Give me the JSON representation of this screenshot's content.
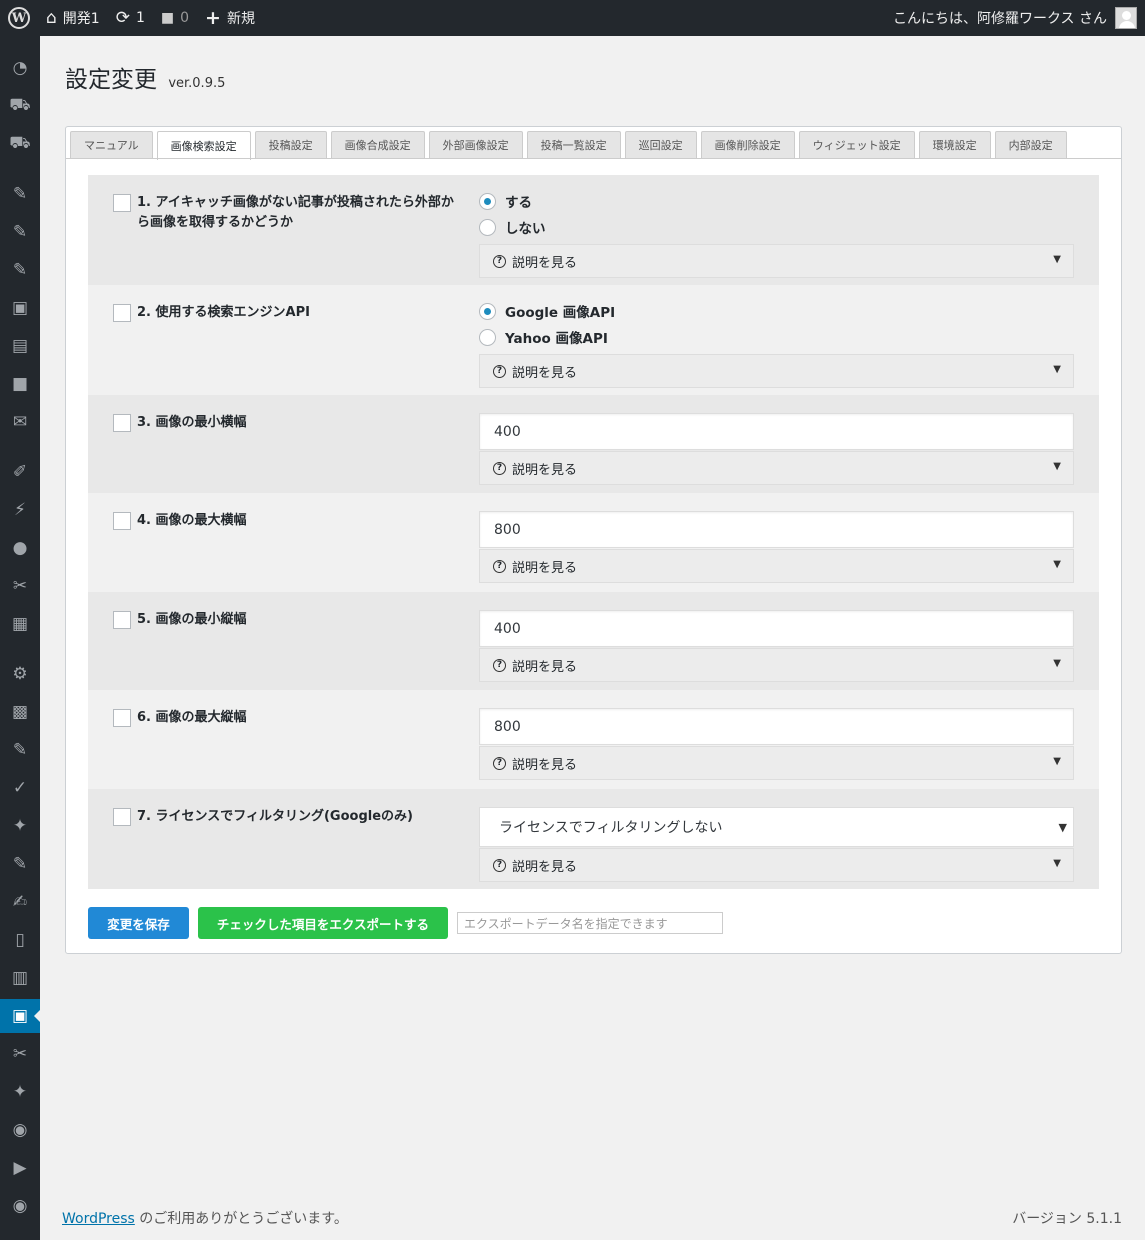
{
  "adminbar": {
    "site_name": "開発1",
    "updates_count": "1",
    "comments_count": "0",
    "new_label": "新規",
    "greeting": "こんにちは、阿修羅ワークス さん"
  },
  "page": {
    "title": "設定変更",
    "version": "ver.0.9.5"
  },
  "tabs": [
    {
      "label": "マニュアル"
    },
    {
      "label": "画像検索設定"
    },
    {
      "label": "投稿設定"
    },
    {
      "label": "画像合成設定"
    },
    {
      "label": "外部画像設定"
    },
    {
      "label": "投稿一覧設定"
    },
    {
      "label": "巡回設定"
    },
    {
      "label": "画像削除設定"
    },
    {
      "label": "ウィジェット設定"
    },
    {
      "label": "環境設定"
    },
    {
      "label": "内部設定"
    }
  ],
  "active_tab": "画像検索設定",
  "settings": {
    "help_label": "説明を見る",
    "s1": {
      "label": "1. アイキャッチ画像がない記事が投稿されたら外部から画像を取得するかどうか",
      "options": [
        "する",
        "しない"
      ],
      "selected": "する"
    },
    "s2": {
      "label": "2. 使用する検索エンジンAPI",
      "options": [
        "Google 画像API",
        "Yahoo 画像API"
      ],
      "selected": "Google 画像API"
    },
    "s3": {
      "label": "3. 画像の最小横幅",
      "value": "400"
    },
    "s4": {
      "label": "4. 画像の最大横幅",
      "value": "800"
    },
    "s5": {
      "label": "5. 画像の最小縦幅",
      "value": "400"
    },
    "s6": {
      "label": "6. 画像の最大縦幅",
      "value": "800"
    },
    "s7": {
      "label": "7. ライセンスでフィルタリング(Googleのみ)",
      "value": "ライセンスでフィルタリングしない"
    }
  },
  "actions": {
    "save_label": "変更を保存",
    "export_label": "チェックした項目をエクスポートする",
    "export_placeholder": "エクスポートデータ名を指定できます"
  },
  "footer": {
    "link_text": "WordPress",
    "thanks": " のご利用ありがとうございます。",
    "version": "バージョン 5.1.1"
  },
  "colors": {
    "adminbar_bg": "#23282d",
    "current_menu": "#0073aa",
    "save_button": "#2189d6",
    "export_button": "#2bc24a"
  }
}
